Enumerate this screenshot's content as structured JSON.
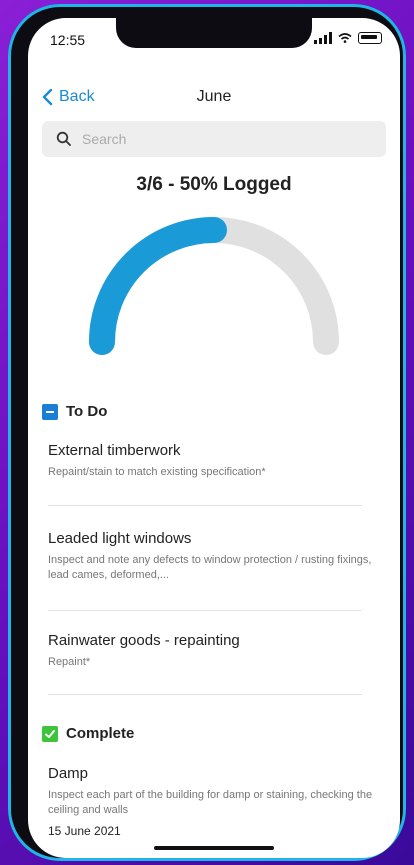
{
  "status_bar": {
    "time": "12:55"
  },
  "nav": {
    "back_label": "Back",
    "title": "June"
  },
  "search": {
    "placeholder": "Search"
  },
  "progress": {
    "label": "3/6 - 50% Logged",
    "fraction": 0.5
  },
  "colors": {
    "accent": "#1a9ad6",
    "track": "#e0e0e0",
    "todo": "#1a7ed4",
    "complete": "#3ec43a"
  },
  "todo": {
    "heading": "To Do",
    "items": [
      {
        "title": "External timberwork",
        "description": "Repaint/stain to match existing specification*"
      },
      {
        "title": "Leaded light windows",
        "description": "Inspect and note any defects to window protection / rusting fixings, lead cames, deformed,..."
      },
      {
        "title": "Rainwater goods - repainting",
        "description": "Repaint*"
      }
    ]
  },
  "complete": {
    "heading": "Complete",
    "items": [
      {
        "title": "Damp",
        "description": "Inspect each part of the building for damp or staining, checking the ceiling and walls",
        "date": "15 June 2021"
      }
    ]
  }
}
